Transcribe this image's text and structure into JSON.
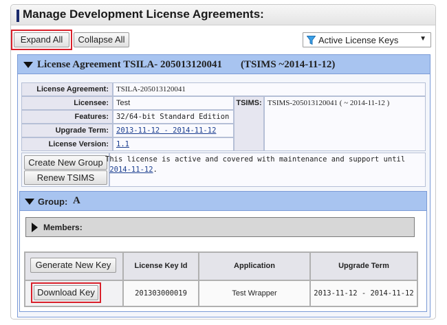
{
  "header": {
    "title": "Manage Development License Agreements:"
  },
  "toolbar": {
    "expand_all": "Expand All",
    "collapse_all": "Collapse All",
    "filter_selected": "Active License Keys",
    "filter_arrow": "▼"
  },
  "agreement": {
    "heading": "License Agreement TSILA- 205013120041",
    "heading_tsims": "(TSIMS ~2014-11-12)",
    "fields": {
      "agreement_label": "License Agreement:",
      "agreement_value": "TSILA-205013120041",
      "licensee_label": "Licensee:",
      "licensee_value": "Test",
      "features_label": "Features:",
      "features_value": "32/64-bit Standard Edition",
      "upgrade_label": "Upgrade Term:",
      "upgrade_value": "2013-11-12 - 2014-11-12",
      "version_label": "License Version:",
      "version_value": "1.1",
      "tsims_label": "TSIMS:",
      "tsims_value": "TSIMS-205013120041 ( ~ 2014-11-12 )"
    },
    "buttons": {
      "create_group": "Create New Group",
      "renew_tsims": "Renew TSIMS"
    },
    "status_text": "This license is active and covered with maintenance and support until",
    "status_date": "2014-11-12",
    "status_period": "."
  },
  "group": {
    "label": "Group:",
    "name": "A",
    "members_label": "Members:",
    "generate_key": "Generate New Key",
    "columns": [
      "License Key Id",
      "Application",
      "Upgrade Term"
    ],
    "rows": [
      {
        "action": "Download Key",
        "key_id": "201303000019",
        "application": "Test Wrapper",
        "upgrade_term": "2013-11-12 - 2014-11-12"
      }
    ]
  },
  "colors": {
    "accent": "#1a2a6c",
    "header_blue": "#a8c4f0",
    "highlight": "#d9202a"
  }
}
